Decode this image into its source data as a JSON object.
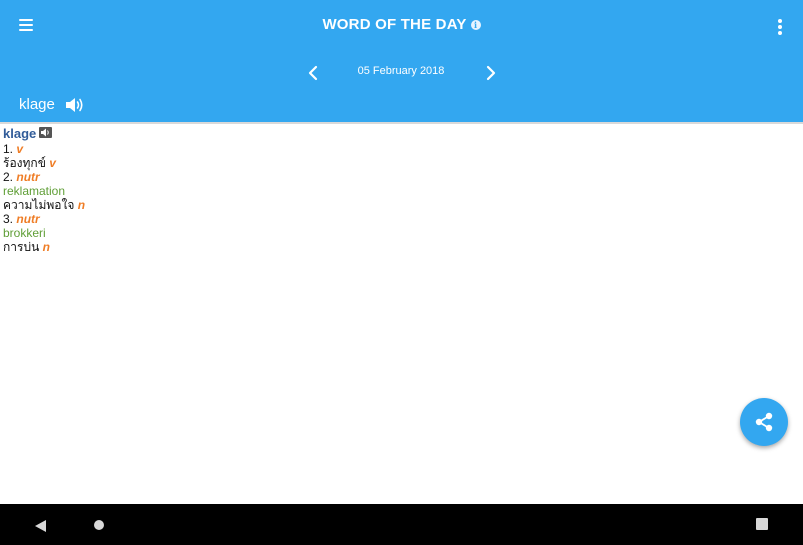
{
  "header": {
    "title": "WORD OF THE DAY",
    "info_icon_glyph": "i",
    "date": "05 February 2018",
    "word": "klage"
  },
  "icons": {
    "menu": "hamburger-menu-icon",
    "info": "info-icon",
    "more": "more-vert-icon",
    "prev": "chevron-left-icon",
    "next": "chevron-right-icon",
    "speaker": "speaker-icon",
    "share": "share-icon"
  },
  "entry": {
    "headword": "klage",
    "senses": [
      {
        "number": "1.",
        "pos": "v",
        "translation": "",
        "thai": "ร้องทุกข์",
        "thai_pos": "v"
      },
      {
        "number": "2.",
        "pos": "nutr",
        "translation": "reklamation",
        "thai": "ความไม่พอใจ",
        "thai_pos": "n"
      },
      {
        "number": "3.",
        "pos": "nutr",
        "translation": "brokkeri",
        "thai": "การบ่น",
        "thai_pos": "n"
      }
    ]
  },
  "colors": {
    "app_bar": "#33a7f0",
    "headword": "#315c99",
    "part_of_speech": "#ef7d26",
    "translation": "#5f9e36",
    "fab": "#33a7f0",
    "nav_bar": "#000000"
  }
}
